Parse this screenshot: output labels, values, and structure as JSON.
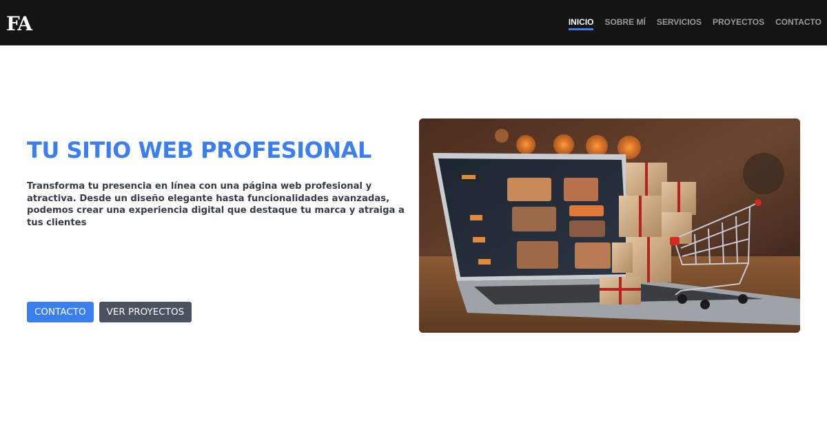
{
  "navbar": {
    "logo": "FA",
    "links": [
      {
        "label": "INICIO",
        "active": true
      },
      {
        "label": "SOBRE MÍ",
        "active": false
      },
      {
        "label": "SERVICIOS",
        "active": false
      },
      {
        "label": "PROYECTOS",
        "active": false
      },
      {
        "label": "CONTACTO",
        "active": false
      }
    ]
  },
  "hero": {
    "title": "TU SITIO WEB PROFESIONAL",
    "description": "Transforma tu presencia en línea con una página web profesional y atractiva. Desde un diseño elegante hasta funcionalidades avanzadas, podemos crear una experiencia digital que destaque tu marca y atraiga a tus clientes",
    "buttons": {
      "primary_label": "CONTACTO",
      "secondary_label": "VER PROYECTOS"
    },
    "image": {
      "subject": "laptop with gift boxes and shopping cart"
    }
  },
  "colors": {
    "navbar_bg": "#141414",
    "accent": "#3b7ef0",
    "secondary_button": "#4a5260",
    "text": "#353c45"
  }
}
